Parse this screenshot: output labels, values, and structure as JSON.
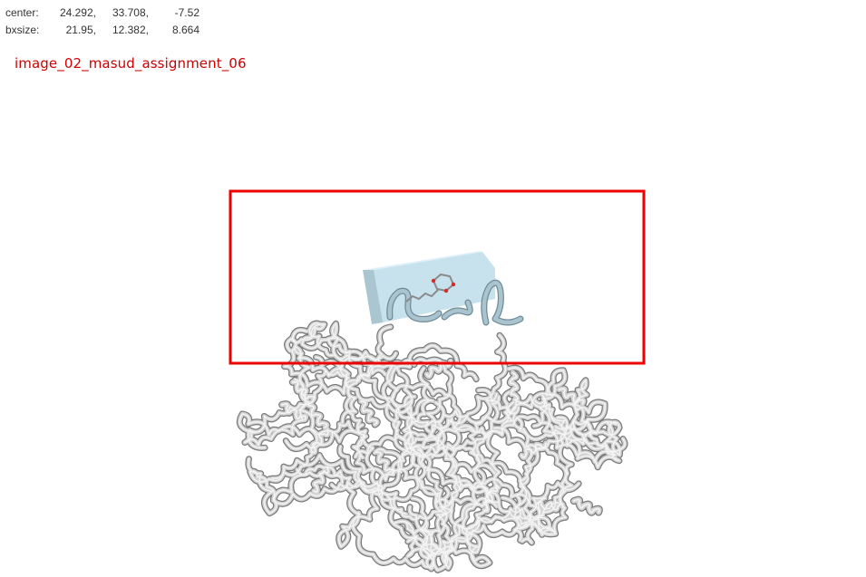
{
  "readout": {
    "center": {
      "label": "center:",
      "x": "24.292,",
      "y": "33.708,",
      "z": "-7.52"
    },
    "bxsize": {
      "label": "bxsize:",
      "x": "21.95,",
      "y": "12.382,",
      "z": "8.664"
    }
  },
  "image_label": "image_02_masud_assignment_06",
  "colors": {
    "label_text": "#cc0000",
    "highlight_box": "#ee0000",
    "grid_box_face": "#c7e2ec",
    "grid_box_side": "#a9c6d1",
    "ribbon": "#d4d4d4",
    "ribbon_shade": "#7a7a7a",
    "ligand_oxygen": "#d42a2a"
  }
}
